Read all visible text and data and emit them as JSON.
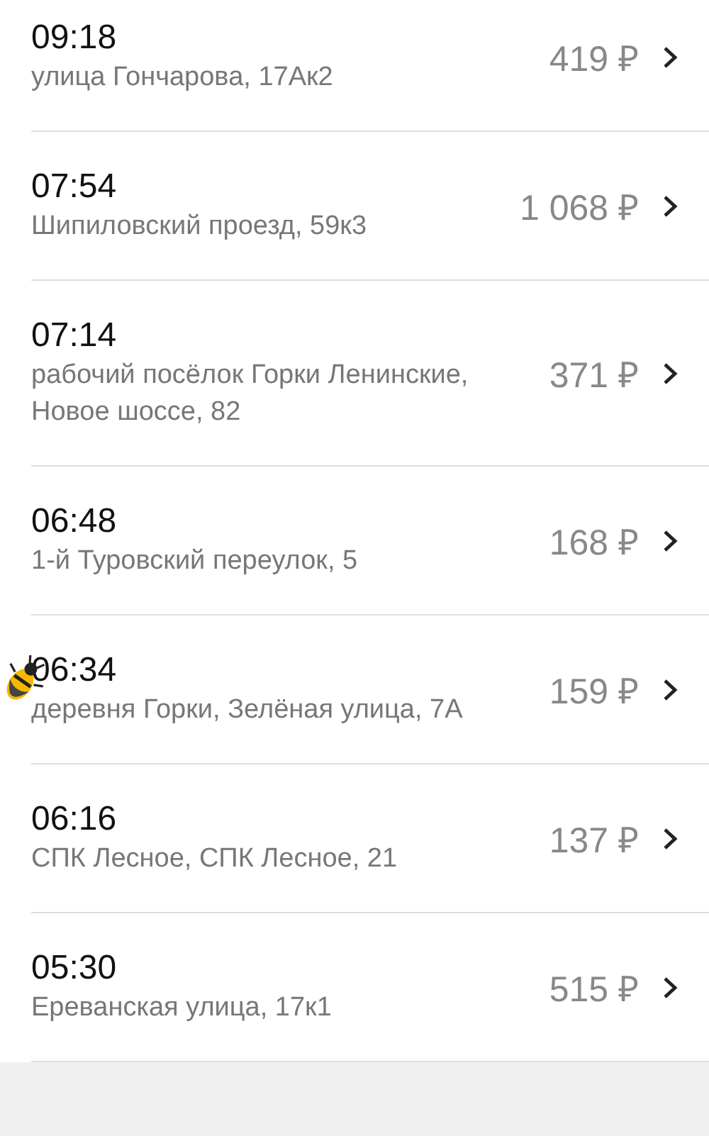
{
  "trips": [
    {
      "time": "09:18",
      "address": "улица Гончарова, 17Ак2",
      "price": "419 ₽"
    },
    {
      "time": "07:54",
      "address": "Шипиловский проезд, 59к3",
      "price": "1 068 ₽"
    },
    {
      "time": "07:14",
      "address": "рабочий посёлок Горки Ленинские, Новое шоссе, 82",
      "price": "371 ₽"
    },
    {
      "time": "06:48",
      "address": "1-й Туровский переулок, 5",
      "price": "168 ₽"
    },
    {
      "time": "06:34",
      "address": "деревня Горки, Зелёная улица, 7А",
      "price": "159 ₽"
    },
    {
      "time": "06:16",
      "address": "СПК Лесное, СПК Лесное, 21",
      "price": "137 ₽"
    },
    {
      "time": "05:30",
      "address": "Ереванская улица, 17к1",
      "price": "515 ₽"
    }
  ]
}
